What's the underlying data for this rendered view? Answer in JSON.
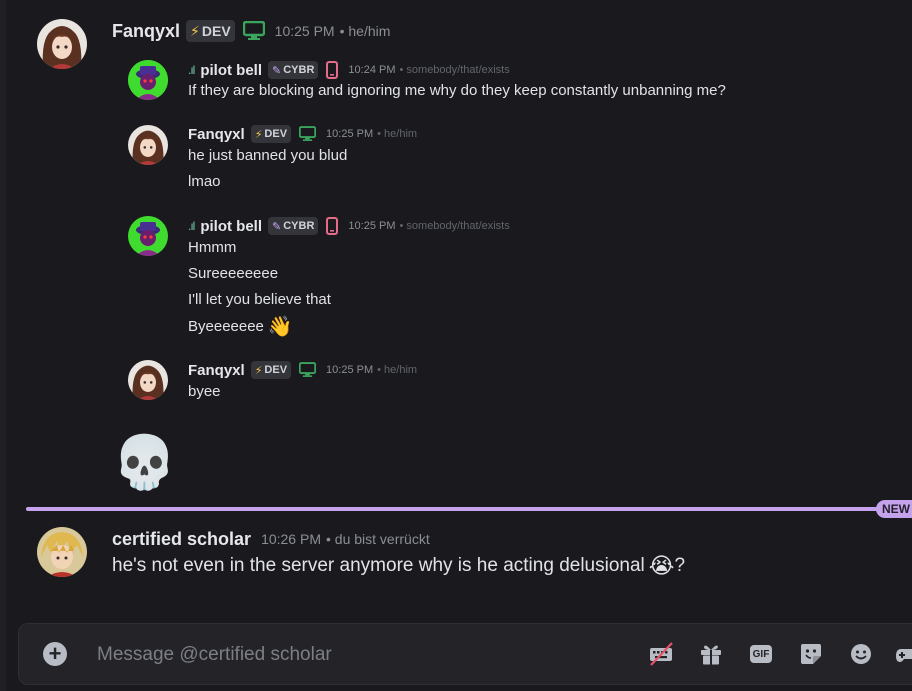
{
  "messages": [
    {
      "author": "Fanqyxl",
      "tag": "DEV",
      "time": "10:25 PM",
      "pronouns": "• he/him",
      "replies": [
        {
          "author": "pilot bell",
          "tag": "CYBR",
          "time": "10:24 PM",
          "pronouns": "• somebody/that/exists",
          "lines": [
            "If they are blocking and ignoring me why do they keep constantly unbanning me?"
          ]
        },
        {
          "author": "Fanqyxl",
          "tag": "DEV",
          "time": "10:25 PM",
          "pronouns": "• he/him",
          "lines": [
            "he just banned you blud",
            "lmao"
          ]
        },
        {
          "author": "pilot bell",
          "tag": "CYBR",
          "time": "10:25 PM",
          "pronouns": "• somebody/that/exists",
          "lines": [
            "Hmmm",
            "Sureeeeeeee",
            "I'll let you believe that",
            "Byeeeeeee"
          ],
          "emoji": "👋"
        },
        {
          "author": "Fanqyxl",
          "tag": "DEV",
          "time": "10:25 PM",
          "pronouns": "• he/him",
          "lines": [
            "byee"
          ]
        }
      ],
      "big_emoji": "💀"
    },
    {
      "author": "certified scholar",
      "time": "10:26 PM",
      "pronouns": "• du bist verrückt",
      "text": "he's not even in the server anymore why is he acting delusional",
      "emoji": "😭",
      "suffix": "?"
    }
  ],
  "new_divider": "NEW",
  "composer": {
    "placeholder": "Message @certified scholar",
    "gif_label": "GIF"
  },
  "colors": {
    "background": "#1a1a1e",
    "new_accent": "#c4a3ec",
    "status_desktop": "#3ba55d",
    "status_mobile": "#e56b8b"
  }
}
